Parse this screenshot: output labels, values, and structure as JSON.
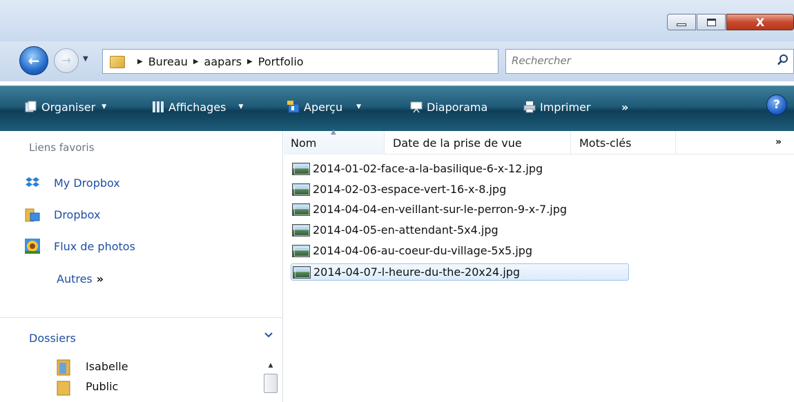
{
  "window": {
    "controls": {
      "minimize": "",
      "maximize": "",
      "close": "X"
    }
  },
  "navigation": {
    "back_glyph": "←",
    "forward_glyph": "→",
    "history_glyph": "▼"
  },
  "address": {
    "breadcrumb": [
      "Bureau",
      "aapars",
      "Portfolio"
    ],
    "separator": "▶",
    "dropdown_glyph": "▼",
    "refresh_glyph": "⇆"
  },
  "search": {
    "placeholder": "Rechercher"
  },
  "toolbar": {
    "organiser": "Organiser",
    "affichages": "Affichages",
    "apercu": "Aperçu",
    "diaporama": "Diaporama",
    "imprimer": "Imprimer",
    "more": "»",
    "caret": "▼",
    "help": "?"
  },
  "sidebar": {
    "favorites_header": "Liens favoris",
    "favorites": [
      {
        "label": "My Dropbox",
        "icon": "dropbox-icon"
      },
      {
        "label": "Dropbox",
        "icon": "folder-icon"
      },
      {
        "label": "Flux de photos",
        "icon": "sunflower-icon"
      }
    ],
    "more_label": "Autres",
    "more_glyph": "»",
    "folders_header": "Dossiers",
    "folders_chevron": "⌄",
    "folders": [
      {
        "label": "Isabelle"
      },
      {
        "label": "Public"
      }
    ],
    "scroll_up_glyph": "▲"
  },
  "file_list": {
    "columns": [
      "Nom",
      "Date de la prise de vue",
      "Mots-clés"
    ],
    "sort_glyph": "▲",
    "more_columns_glyph": "»",
    "files": [
      "2014-01-02-face-a-la-basilique-6-x-12.jpg",
      "2014-02-03-espace-vert-16-x-8.jpg",
      "2014-04-04-en-veillant-sur-le-perron-9-x-7.jpg",
      "2014-04-05-en-attendant-5x4.jpg",
      "2014-04-06-au-coeur-du-village-5x5.jpg",
      "2014-04-07-l-heure-du-the-20x24.jpg"
    ],
    "selected_index": 5
  },
  "colors": {
    "link_blue": "#1e4fa3",
    "toolbar_dark": "#0e3f5a",
    "close_red": "#c74b2e"
  }
}
